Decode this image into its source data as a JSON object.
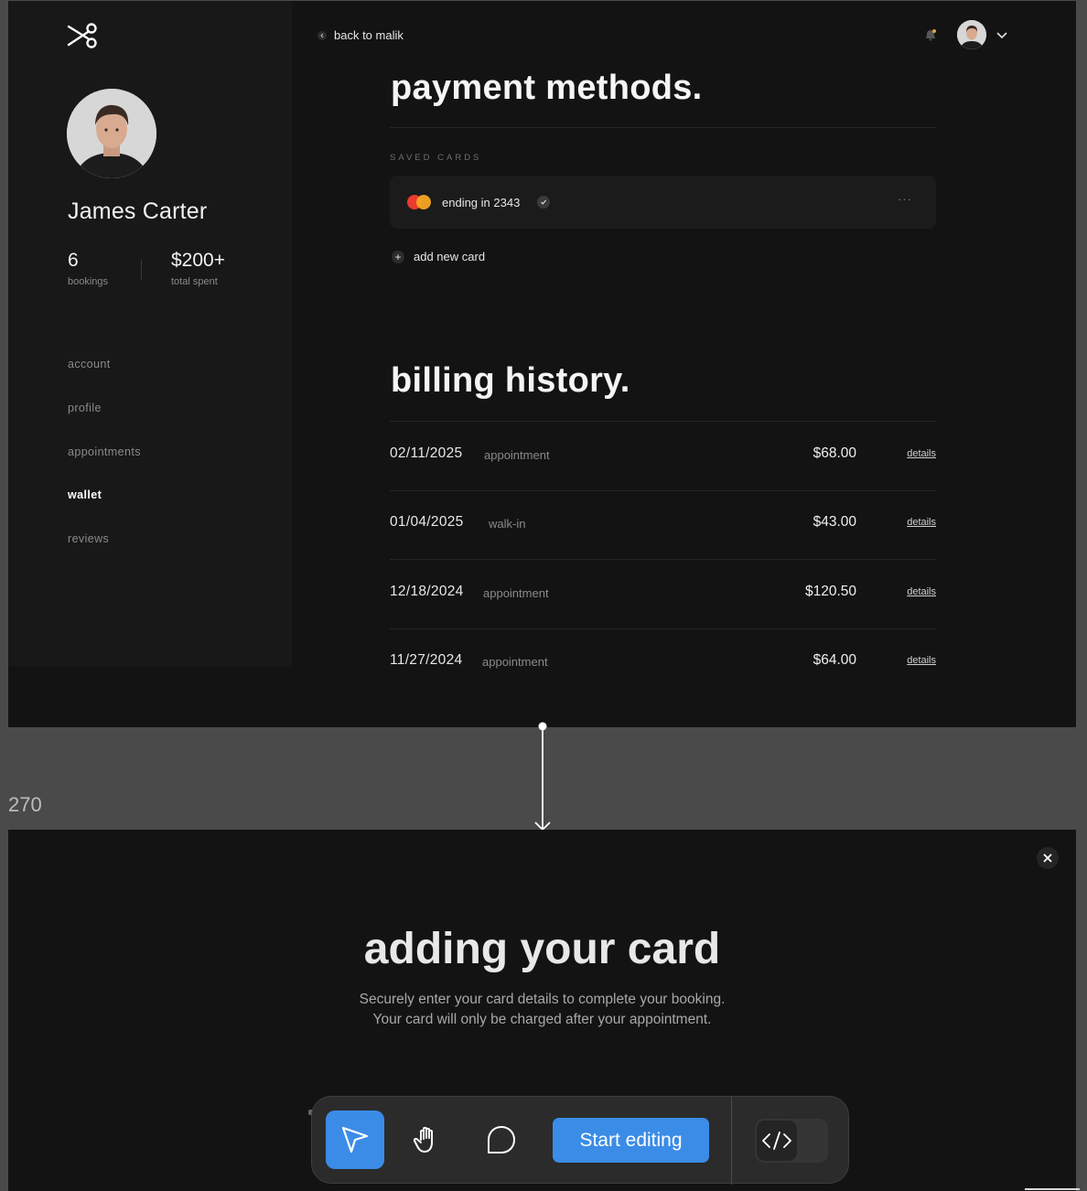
{
  "user": {
    "name": "James Carter"
  },
  "stats": [
    {
      "value": "6",
      "label": "bookings"
    },
    {
      "value": "$200+",
      "label": "total spent"
    }
  ],
  "nav": [
    {
      "label": "account",
      "active": false
    },
    {
      "label": "profile",
      "active": false
    },
    {
      "label": "appointments",
      "active": false
    },
    {
      "label": "wallet",
      "active": true
    },
    {
      "label": "reviews",
      "active": false
    }
  ],
  "header": {
    "back_label": "back to malik"
  },
  "payment": {
    "title": "payment methods.",
    "section_label": "SAVED CARDS",
    "card": {
      "brand_icon": "mastercard-icon",
      "label": "ending in 2343",
      "menu": "···"
    },
    "add_card_label": "add new card"
  },
  "billing": {
    "title": "billing history.",
    "rows": [
      {
        "date": "02/11/2025",
        "type": "appointment",
        "amount": "$68.00",
        "link": "details"
      },
      {
        "date": "01/04/2025",
        "type": "walk-in",
        "amount": "$43.00",
        "link": "details"
      },
      {
        "date": "12/18/2024",
        "type": "appointment",
        "amount": "$120.50",
        "link": "details"
      },
      {
        "date": "11/27/2024",
        "type": "appointment",
        "amount": "$64.00",
        "link": "details"
      }
    ]
  },
  "canvas": {
    "frame_number": "270"
  },
  "modal": {
    "title": "adding your card",
    "subtitle_line1": "Securely enter your card details to complete your booking.",
    "subtitle_line2": "Your card will only be charged after your appointment."
  },
  "toolbar": {
    "tools": [
      "pointer-icon",
      "hand-icon",
      "comment-icon"
    ],
    "start_label": "Start editing",
    "code_icon": "code-icon"
  },
  "colors": {
    "accent": "#3b8ce6",
    "background": "#131313",
    "canvas": "#4a4a4a"
  }
}
